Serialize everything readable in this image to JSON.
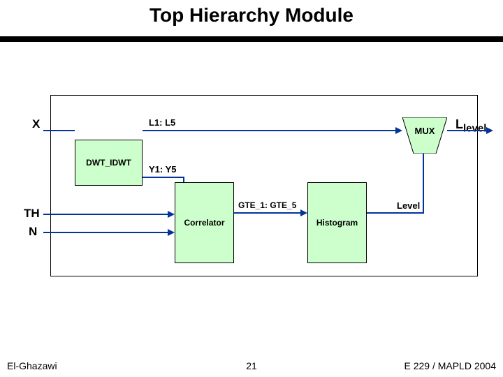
{
  "title": "Top Hierarchy Module",
  "labels": {
    "x": "X",
    "th": "TH",
    "n": "N",
    "l1l5": "L1: L5",
    "y1y5": "Y1: Y5",
    "gte": "GTE_1: GTE_5",
    "level_out": "Level",
    "l_level_prefix": "L",
    "l_level_sub": "level",
    "mux": "MUX"
  },
  "blocks": {
    "dwt": "DWT_IDWT",
    "correlator": "Correlator",
    "histogram": "Histogram"
  },
  "footer": {
    "left": "El-Ghazawi",
    "center": "21",
    "right": "E 229 / MAPLD 2004"
  }
}
